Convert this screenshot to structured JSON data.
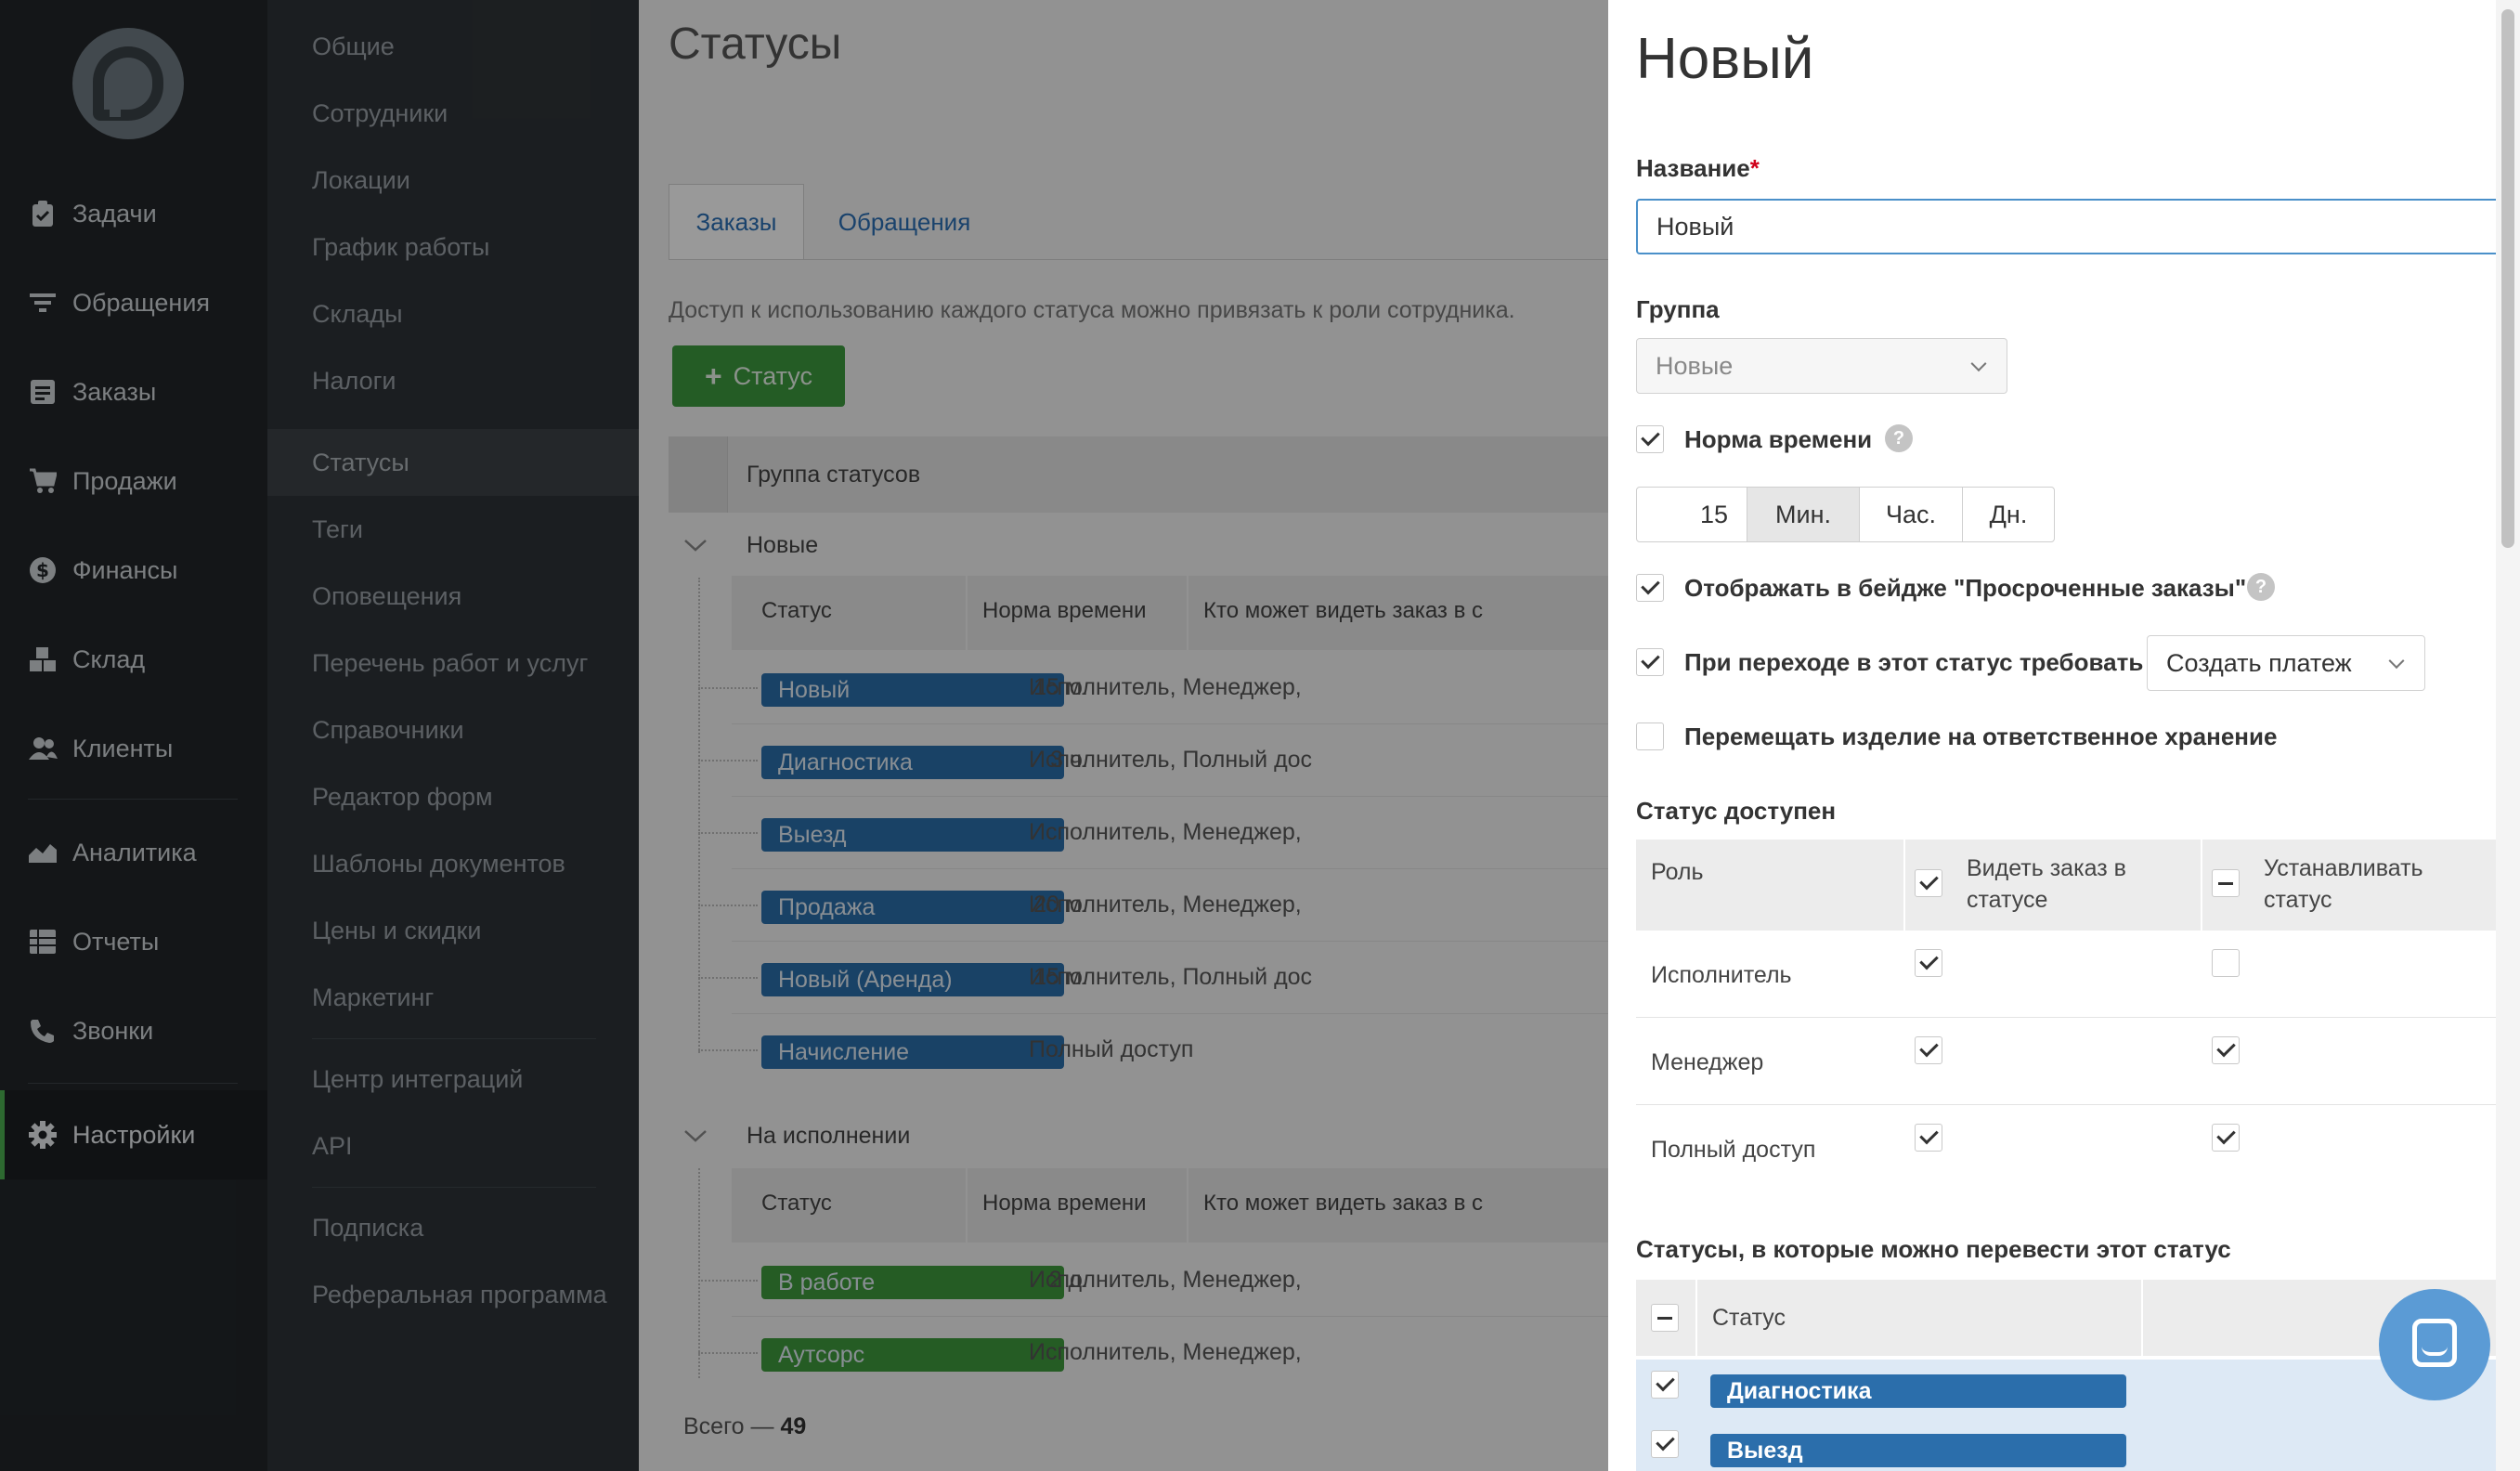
{
  "nav": {
    "items": [
      {
        "label": "Задачи",
        "icon": "clipboard-icon"
      },
      {
        "label": "Обращения",
        "icon": "filter-icon"
      },
      {
        "label": "Заказы",
        "icon": "order-list-icon"
      },
      {
        "label": "Продажи",
        "icon": "cart-icon"
      },
      {
        "label": "Финансы",
        "icon": "dollar-icon"
      },
      {
        "label": "Склад",
        "icon": "boxes-icon"
      },
      {
        "label": "Клиенты",
        "icon": "users-icon"
      },
      {
        "label": "Аналитика",
        "icon": "area-chart-icon"
      },
      {
        "label": "Отчеты",
        "icon": "report-table-icon"
      },
      {
        "label": "Звонки",
        "icon": "phone-icon"
      },
      {
        "label": "Настройки",
        "icon": "gear-icon"
      }
    ],
    "active": "Настройки"
  },
  "menu": {
    "items": [
      "Общие",
      "Сотрудники",
      "Локации",
      "График работы",
      "Склады",
      "Налоги",
      "Статусы",
      "Теги",
      "Оповещения",
      "Перечень работ и услуг",
      "Справочники",
      "Редактор форм",
      "Шаблоны документов",
      "Цены и скидки",
      "Маркетинг",
      "Центр интеграций",
      "API",
      "Подписка",
      "Реферальная программа"
    ],
    "active": "Статусы"
  },
  "main": {
    "title": "Статусы",
    "tabs": [
      "Заказы",
      "Обращения"
    ],
    "hint": "Доступ к использованию каждого статуса можно привязать к роли сотрудника.",
    "add_button": "Статус",
    "group_header": "Группа статусов",
    "col_status": "Статус",
    "col_norm": "Норма времени",
    "col_who": "Кто может видеть заказ в с",
    "groups": [
      {
        "name": "Новые",
        "rows": [
          {
            "status": "Новый",
            "norm": "15 м.",
            "who": "Исполнитель,  Менеджер,",
            "color": "#2b6eab"
          },
          {
            "status": "Диагностика",
            "norm": "3 ч.",
            "who": "Исполнитель,  Полный дос",
            "color": "#2b6eab"
          },
          {
            "status": "Выезд",
            "norm": "",
            "who": "Исполнитель,  Менеджер,",
            "color": "#2b6eab"
          },
          {
            "status": "Продажа",
            "norm": "20 м.",
            "who": "Исполнитель,  Менеджер,",
            "color": "#2b6eab"
          },
          {
            "status": "Новый (Аренда)",
            "norm": "15 м.",
            "who": "Исполнитель,  Полный дос",
            "color": "#2b6eab"
          },
          {
            "status": "Начисление",
            "norm": "",
            "who": "Полный доступ",
            "color": "#2b6eab"
          }
        ]
      },
      {
        "name": "На исполнении",
        "rows": [
          {
            "status": "В работе",
            "norm": "2 д.",
            "who": "Исполнитель,  Менеджер,",
            "color": "#3e9a3c"
          },
          {
            "status": "Аутсорс",
            "norm": "",
            "who": "Исполнитель,  Менеджер,",
            "color": "#3e9a3c"
          }
        ]
      }
    ],
    "total_label": "Всего —",
    "total_value": "49"
  },
  "panel": {
    "title": "Новый",
    "name_label": "Название",
    "required_mark": "*",
    "name_value": "Новый",
    "group_label": "Группа",
    "group_value": "Новые",
    "time_norm_label": "Норма времени",
    "time_norm_checked": true,
    "time_value": "15",
    "units": [
      "Мин.",
      "Час.",
      "Дн."
    ],
    "unit_selected": "Мин.",
    "badge_label": "Отображать в бейдже \"Просроченные заказы\"",
    "badge_checked": true,
    "require_label": "При переходе в этот статус требовать",
    "require_checked": true,
    "require_value": "Создать платеж",
    "move_label": "Перемещать изделие на ответственное хранение",
    "move_checked": false,
    "access_label": "Статус доступен",
    "role_col": "Роль",
    "see_col_1": "Видеть заказ в",
    "see_col_2": "статусе",
    "set_col_1": "Устанавливать",
    "set_col_2": "статус",
    "roles": [
      {
        "name": "Исполнитель",
        "see": true,
        "set": false
      },
      {
        "name": "Менеджер",
        "see": true,
        "set": true
      },
      {
        "name": "Полный доступ",
        "see": true,
        "set": true
      }
    ],
    "transitions_label": "Статусы, в которые можно перевести этот статус",
    "transitions_col": "Статус",
    "transitions": [
      {
        "name": "Диагностика",
        "checked": true
      },
      {
        "name": "Выезд",
        "checked": true
      }
    ]
  },
  "colors": {
    "accent_green": "#3c9a3f",
    "status_blue": "#2b6eab",
    "status_green": "#3e9a3c",
    "input_focus": "#4a90c9",
    "required": "#d0021b"
  }
}
